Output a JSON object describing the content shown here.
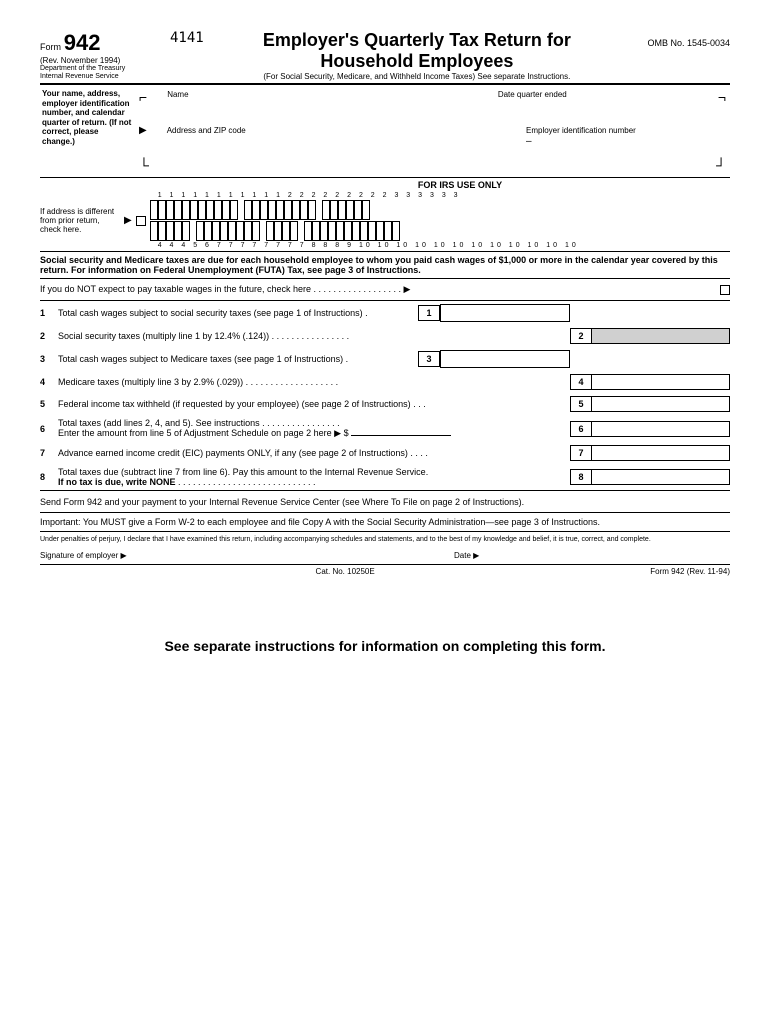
{
  "header": {
    "form_word": "Form",
    "form_number": "942",
    "rev_date": "(Rev. November 1994)",
    "dept1": "Department of the Treasury",
    "dept2": "Internal Revenue Service",
    "code": "4141",
    "title": "Employer's Quarterly Tax Return for Household Employees",
    "subtitle": "(For Social Security, Medicare, and Withheld Income Taxes) See separate Instructions.",
    "omb": "OMB No. 1545-0034"
  },
  "info": {
    "left_text": "Your name, address, employer identification number, and calendar quarter of return. (If not correct, please change.)",
    "name_label": "Name",
    "quarter_label": "Date quarter ended",
    "address_label": "Address and ZIP code",
    "ein_label": "Employer identification number"
  },
  "irs": {
    "title": "FOR IRS USE ONLY",
    "address_check": "If address is different from prior return, check here.",
    "top_numbers": "1 1 1 1 1 1 1 1 1 1 1  2 2 2 2 2 2 2 2 2  3 3 3 3 3 3",
    "bottom_numbers": "4 4 4 5 6  7 7 7 7 7 7 7 7  8 8 8 9  10 10 10 10 10 10 10 10 10 10 10 10"
  },
  "bold_note": "Social security and Medicare taxes are due for each household employee to whom you paid cash wages of $1,000 or more in the calendar year covered by this return. For information on Federal Unemployment (FUTA) Tax, see page 3 of Instructions.",
  "not_expect": "If you do NOT expect to pay taxable wages in the future, check here",
  "lines": {
    "l1": "Total cash wages subject to social security taxes (see page 1 of Instructions) .",
    "l2": "Social security taxes (multiply line 1 by 12.4% (.124))",
    "l3": "Total cash wages subject to Medicare taxes (see page 1 of Instructions) .",
    "l4": "Medicare taxes (multiply line 3 by 2.9% (.029))",
    "l5": "Federal income tax withheld (if requested by your employee) (see page 2 of Instructions)",
    "l6": "Total taxes (add lines 2, 4, and 5). See instructions",
    "l6b": "Enter the amount from line 5 of Adjustment Schedule on page 2 here ▶ $",
    "l7": "Advance earned income credit (EIC) payments ONLY, if any (see page 2 of Instructions)",
    "l8": "Total taxes due (subtract line 7 from line 6). Pay this amount to the Internal Revenue Service.",
    "l8b": "If no tax is due, write NONE",
    "send": "Send Form 942 and your payment to your Internal Revenue Service Center (see Where To File on page 2 of Instructions)."
  },
  "important": "Important: You MUST give a Form W-2 to each employee and file Copy A with the Social Security Administration—see page 3 of Instructions.",
  "perjury": "Under penalties of perjury, I declare that I have examined this return, including accompanying schedules and statements, and to the best of my knowledge and belief, it is true, correct, and complete.",
  "signature": {
    "label": "Signature of employer ▶",
    "date": "Date ▶"
  },
  "footer": {
    "cat": "Cat. No. 10250E",
    "form": "Form 942 (Rev. 11-94)"
  },
  "bottom_note": "See separate instructions for information on completing this form."
}
